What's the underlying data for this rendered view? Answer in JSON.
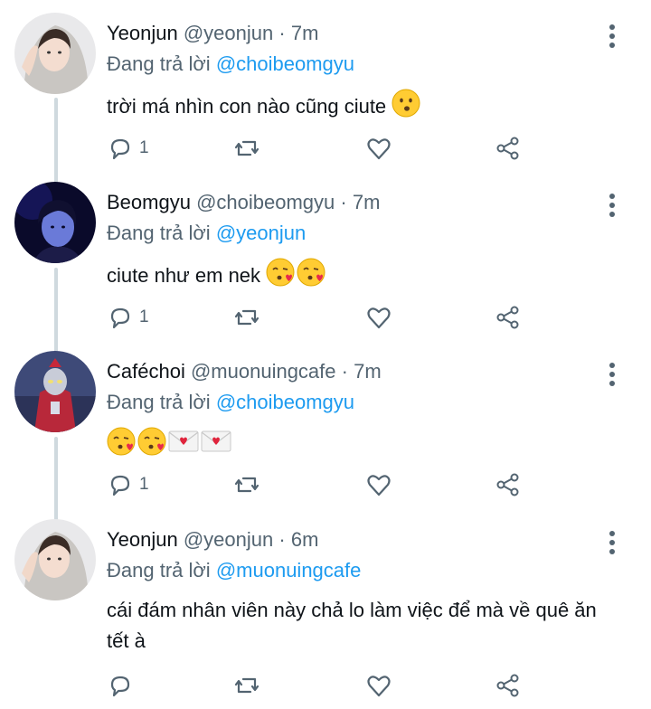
{
  "colors": {
    "accent": "#1d9bf0",
    "muted": "#536471",
    "text": "#0f1419",
    "thread": "#cfd9de"
  },
  "reply_prefix": "Đang trả lời",
  "tweets": [
    {
      "name": "Yeonjun",
      "handle": "@yeonjun",
      "dot": "·",
      "time": "7m",
      "reply_to": "@choibeomgyu",
      "text": "trời má nhìn con nào cũng ciute",
      "emojis": [
        "kissing-face"
      ],
      "reply_count": "1",
      "avatar": "hooded-person"
    },
    {
      "name": "Beomgyu",
      "handle": "@choibeomgyu",
      "dot": "·",
      "time": "7m",
      "reply_to": "@yeonjun",
      "text": "ciute như em nek",
      "emojis": [
        "kissing-heart-face",
        "kissing-heart-face"
      ],
      "reply_count": "1",
      "avatar": "blue-lit-person"
    },
    {
      "name": "Caféchoi",
      "handle": "@muonuingcafe",
      "dot": "·",
      "time": "7m",
      "reply_to": "@choibeomgyu",
      "text": "",
      "emojis": [
        "kissing-heart-face",
        "kissing-heart-face",
        "love-letter",
        "love-letter"
      ],
      "reply_count": "1",
      "avatar": "red-hero-figure"
    },
    {
      "name": "Yeonjun",
      "handle": "@yeonjun",
      "dot": "·",
      "time": "6m",
      "reply_to": "@muonuingcafe",
      "text": "cái đám nhân viên này chả lo làm việc để mà về quê ăn tết à",
      "emojis": [],
      "reply_count": "",
      "avatar": "hooded-person"
    }
  ]
}
